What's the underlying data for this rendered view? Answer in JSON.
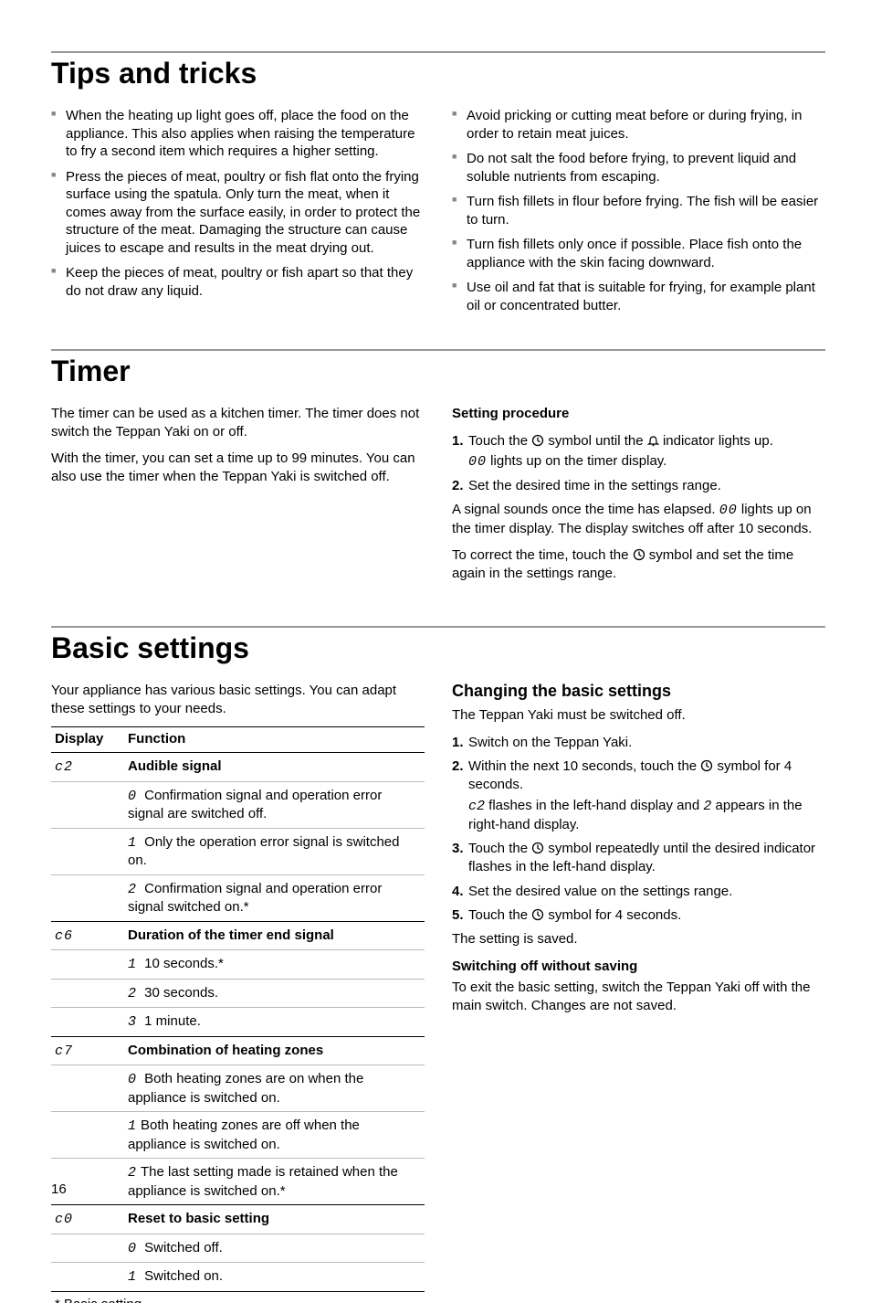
{
  "page_number": "16",
  "sections": {
    "tips": {
      "heading": "Tips and tricks",
      "left": [
        "When the heating up light goes off, place the food on the appliance. This also applies when raising the temperature to fry a second item which requires a higher setting.",
        "Press the pieces of meat, poultry or fish flat onto the frying surface using the spatula. Only turn the meat, when it comes away from the surface easily, in order to protect the structure of the meat. Damaging the structure can cause juices to escape and results in the meat drying out.",
        "Keep the pieces of meat, poultry or fish apart so that they do not draw any liquid."
      ],
      "right": [
        "Avoid pricking or cutting meat before or during frying, in order to retain meat juices.",
        "Do not salt the food before frying, to prevent liquid and soluble nutrients from escaping.",
        "Turn fish fillets in flour before frying. The fish will be easier to turn.",
        "Turn fish fillets only once if possible. Place fish onto the appliance with the skin facing downward.",
        "Use oil and fat that is suitable for frying, for example plant oil or concentrated butter."
      ]
    },
    "timer": {
      "heading": "Timer",
      "intro1": "The timer can be used as a kitchen timer. The timer does not switch the Teppan Yaki on or off.",
      "intro2": "With the timer, you can set a time up to 99 minutes. You can also use the timer when the Teppan Yaki is switched off.",
      "procedure_heading": "Setting procedure",
      "step1_a": "Touch the ",
      "step1_b": " symbol until the ",
      "step1_c": " indicator lights up.",
      "step1_sub_a": "00",
      "step1_sub_b": " lights up on the timer display.",
      "step2": "Set the desired time in the settings range.",
      "after_a": "A signal sounds once the time has elapsed. ",
      "after_b": "00",
      "after_c": " lights up on the timer display. The display switches off after 10 seconds.",
      "correct_a": "To correct the time, touch the ",
      "correct_b": " symbol and set the time again in the settings range."
    },
    "basic": {
      "heading": "Basic settings",
      "intro": "Your appliance has various basic settings. You can adapt these settings to your needs.",
      "table": {
        "col_display": "Display",
        "col_function": "Function",
        "rows": [
          {
            "display": "c2",
            "header": "Audible signal",
            "options": [
              {
                "sym": "0",
                "text": " Confirmation signal and operation error signal are switched off."
              },
              {
                "sym": "1",
                "text": " Only the operation error signal is switched on."
              },
              {
                "sym": "2",
                "text": " Confirmation signal and operation error signal switched on.*"
              }
            ]
          },
          {
            "display": "c6",
            "header": "Duration of the timer end signal",
            "options": [
              {
                "sym": "1",
                "text": " 10 seconds.*"
              },
              {
                "sym": "2",
                "text": "   30 seconds."
              },
              {
                "sym": "3",
                "text": " 1 minute."
              }
            ]
          },
          {
            "display": "c7",
            "header": "Combination of heating zones",
            "options": [
              {
                "sym": "0",
                "text": " Both heating zones are on when the appliance is switched on."
              },
              {
                "sym": "1",
                "text": "Both heating zones are off when the appliance is switched on."
              },
              {
                "sym": "2",
                "text": "The last setting made is retained when the appliance is switched on.*"
              }
            ]
          },
          {
            "display": "c0",
            "header": "Reset to basic setting",
            "options": [
              {
                "sym": "0",
                "text": " Switched off."
              },
              {
                "sym": "1",
                "text": " Switched on."
              }
            ]
          }
        ],
        "footnote": "* Basic setting"
      },
      "changing": {
        "heading": "Changing the basic settings",
        "intro": "The Teppan Yaki must be switched off.",
        "steps": {
          "s1": "Switch on the Teppan Yaki.",
          "s2_a": "Within the next 10 seconds, touch the ",
          "s2_b": " symbol for 4 seconds.",
          "s2_sub_a": "c2",
          "s2_sub_b": " flashes in the left-hand display and ",
          "s2_sub_c": "2",
          "s2_sub_d": " appears in the right-hand display.",
          "s3_a": "Touch the ",
          "s3_b": " symbol repeatedly until the desired indicator flashes in the left-hand display.",
          "s4": "Set the desired value on the settings range.",
          "s5_a": "Touch the ",
          "s5_b": " symbol for 4 seconds."
        },
        "saved": "The setting is saved.",
        "switch_off_heading": "Switching off without saving",
        "switch_off_body": "To exit the basic setting, switch the Teppan Yaki off with the main switch. Changes are not saved."
      }
    }
  }
}
